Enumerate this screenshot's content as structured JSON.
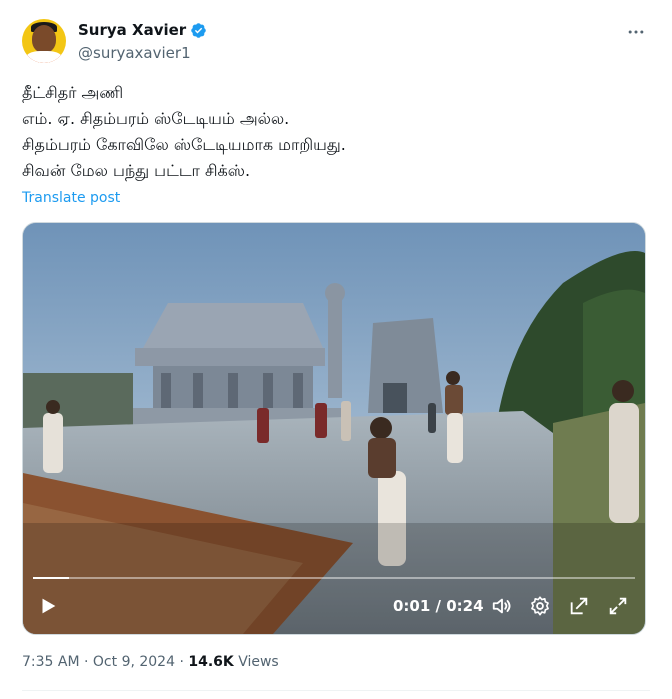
{
  "author": {
    "display_name": "Surya Xavier",
    "handle": "@suryaxavier1",
    "verified": true
  },
  "tweet": {
    "lines": [
      "தீட்சிதர் அணி",
      "எம். ஏ. சிதம்பரம் ஸ்டேடியம் அல்ல.",
      "சிதம்பரம் கோவிலே ஸ்டேடியமாக மாறியது.",
      "சிவன் மேல பந்து பட்டா சிக்ஸ்."
    ],
    "translate_label": "Translate post"
  },
  "video": {
    "current_time": "0:01",
    "duration": "0:24",
    "time_display": "0:01 / 0:24",
    "progress_fraction": 0.06
  },
  "meta": {
    "time": "7:35 AM",
    "separator": " · ",
    "date": "Oct 9, 2024",
    "views_count": "14.6K",
    "views_label": " Views"
  },
  "colors": {
    "accent": "#1d9bf0",
    "text_primary": "#0f1419",
    "text_secondary": "#536471"
  },
  "icons": {
    "more": "more-horizontal-icon",
    "verified": "verified-badge-icon",
    "play": "play-icon",
    "volume": "volume-icon",
    "settings": "settings-gear-icon",
    "pip": "picture-in-picture-icon",
    "fullscreen": "fullscreen-icon"
  }
}
